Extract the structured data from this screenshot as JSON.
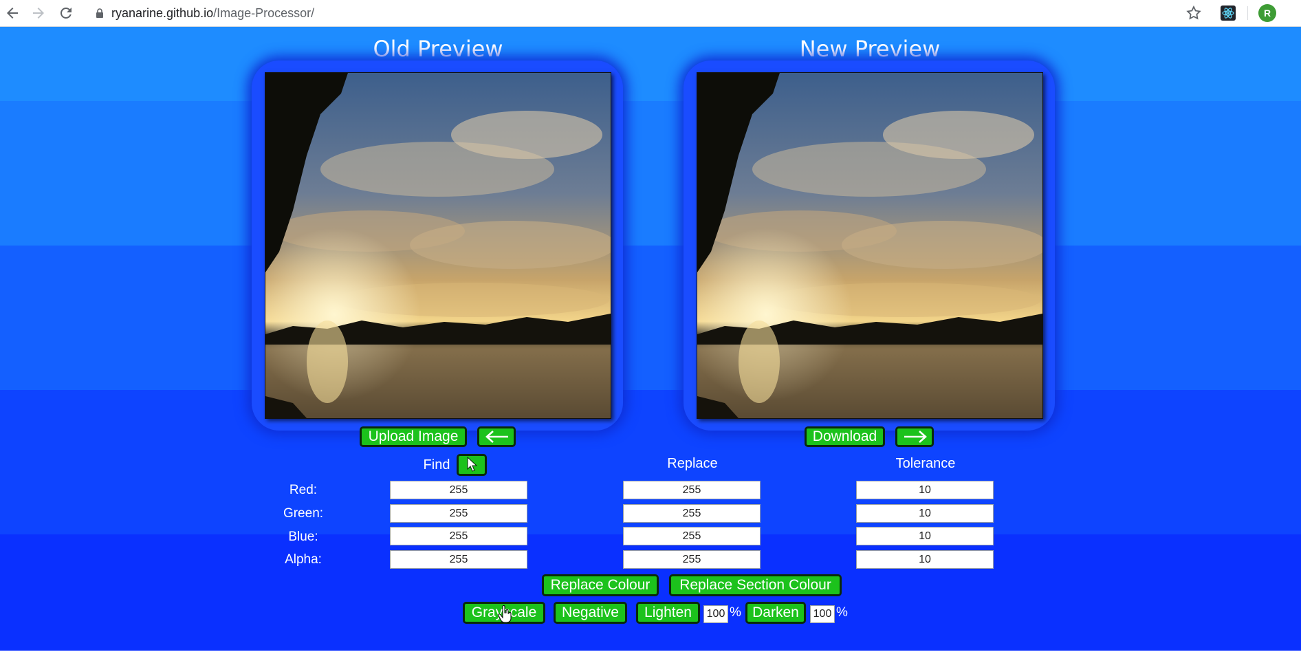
{
  "browser": {
    "url_host": "ryanarine.github.io",
    "url_path": "/Image-Processor/",
    "profile_initial": "R"
  },
  "previews": {
    "old_title": "Old Preview",
    "new_title": "New Preview"
  },
  "buttons": {
    "upload": "Upload Image",
    "download": "Download",
    "replace_colour": "Replace Colour",
    "replace_section_colour": "Replace Section Colour",
    "grayscale": "Grayscale",
    "negative": "Negative",
    "lighten": "Lighten",
    "darken": "Darken"
  },
  "icons": {
    "back_arrow": "arrow-left-icon",
    "forward_arrow": "arrow-right-icon",
    "picker": "cursor-pointer-icon"
  },
  "columns": {
    "find": "Find",
    "replace": "Replace",
    "tolerance": "Tolerance"
  },
  "rows": {
    "red": "Red:",
    "green": "Green:",
    "blue": "Blue:",
    "alpha": "Alpha:"
  },
  "values": {
    "find": {
      "red": "255",
      "green": "255",
      "blue": "255",
      "alpha": "255"
    },
    "replace": {
      "red": "255",
      "green": "255",
      "blue": "255",
      "alpha": "255"
    },
    "tolerance": {
      "red": "10",
      "green": "10",
      "blue": "10",
      "alpha": "10"
    }
  },
  "percent": {
    "lighten": "100",
    "darken": "100",
    "sign": "%"
  },
  "colors": {
    "button_green": "#1cc21c",
    "page_blue": "#1460ff"
  }
}
